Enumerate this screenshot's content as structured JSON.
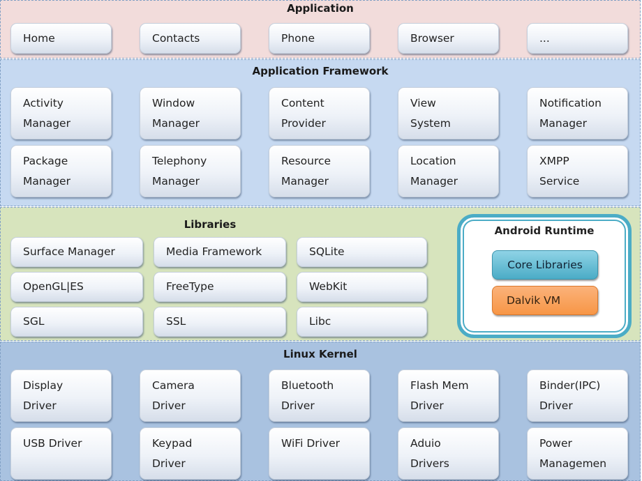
{
  "application": {
    "title": "Application",
    "items": [
      "Home",
      "Contacts",
      "Phone",
      "Browser",
      "..."
    ]
  },
  "framework": {
    "title": "Application Framework",
    "items": [
      [
        "Activity",
        "Manager"
      ],
      [
        "Window",
        "Manager"
      ],
      [
        "Content",
        "Provider"
      ],
      [
        "View",
        "System"
      ],
      [
        "Notification",
        "Manager"
      ],
      [
        "Package",
        "Manager"
      ],
      [
        "Telephony",
        "Manager"
      ],
      [
        "Resource",
        "Manager"
      ],
      [
        "Location",
        "Manager"
      ],
      [
        "XMPP",
        "Service"
      ]
    ]
  },
  "libraries": {
    "title": "Libraries",
    "items": [
      "Surface Manager",
      "Media Framework",
      "SQLite",
      "OpenGL|ES",
      "FreeType",
      "WebKit",
      "SGL",
      "SSL",
      "Libc"
    ]
  },
  "runtime": {
    "title": "Android Runtime",
    "core": "Core Libraries",
    "vm": "Dalvik VM"
  },
  "kernel": {
    "title": "Linux Kernel",
    "items": [
      [
        "Display",
        "Driver"
      ],
      [
        "Camera",
        "Driver"
      ],
      [
        "Bluetooth",
        "Driver"
      ],
      [
        "Flash Mem",
        " Driver"
      ],
      [
        "Binder(IPC)",
        "Driver"
      ],
      [
        "USB Driver",
        ""
      ],
      [
        "Keypad",
        "Driver"
      ],
      [
        "WiFi Driver",
        ""
      ],
      [
        "Aduio",
        "Drivers"
      ],
      [
        "Power",
        "Managemen"
      ]
    ]
  },
  "colors": {
    "application": "#f2dcdb",
    "framework": "#c6d9f1",
    "libraries": "#d7e4bd",
    "kernel": "#a9c2e0",
    "core": "#4bacc6",
    "vm": "#f79646"
  }
}
